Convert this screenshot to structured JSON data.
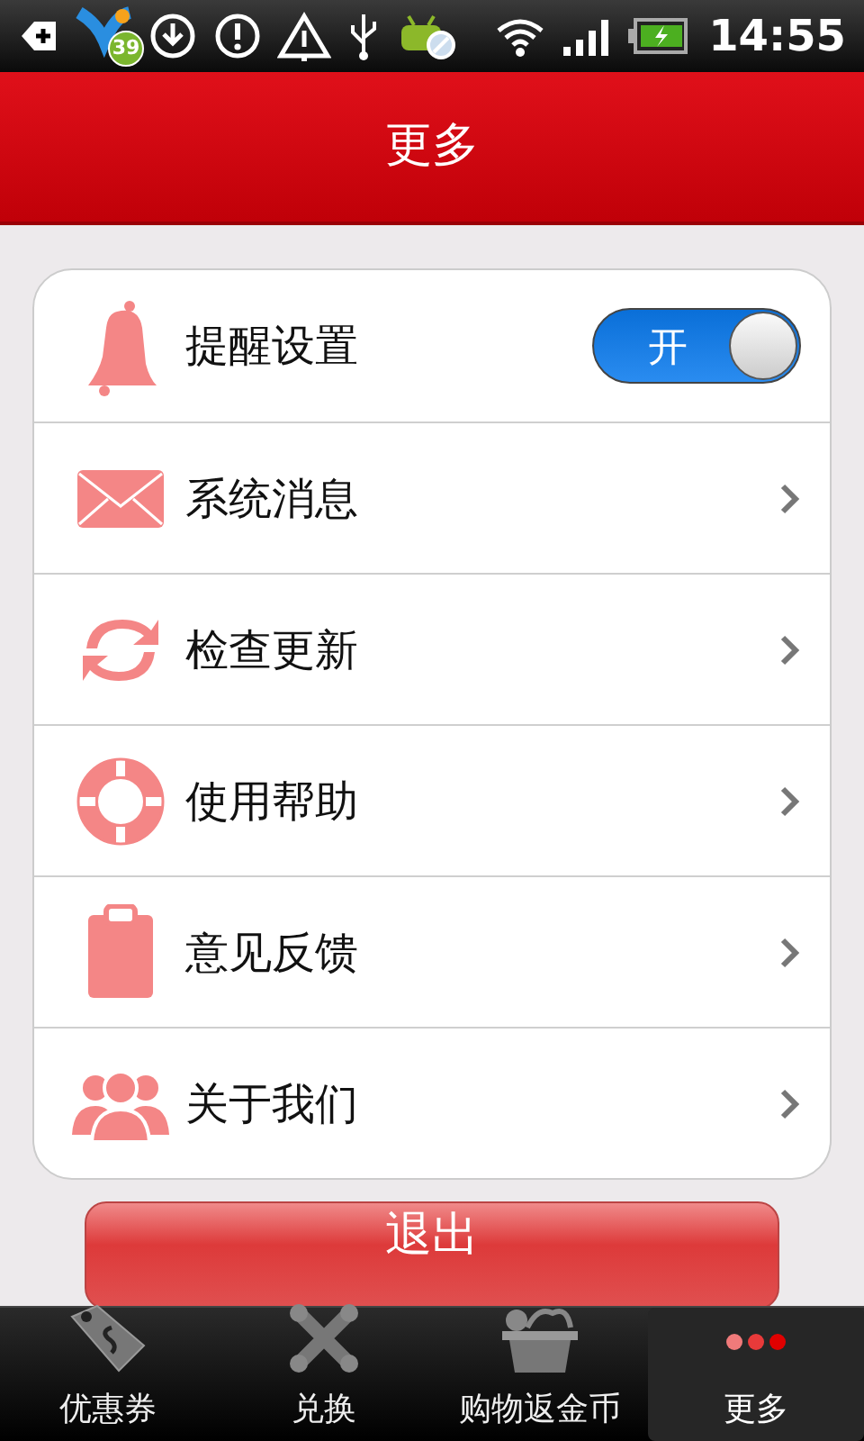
{
  "status_bar": {
    "badge": "39",
    "time": "14:55"
  },
  "header": {
    "title": "更多"
  },
  "settings": [
    {
      "kind": "toggle",
      "label": "提醒设置",
      "on": true,
      "toggle_label": "开"
    },
    {
      "kind": "link",
      "label": "系统消息"
    },
    {
      "kind": "link",
      "label": "检查更新"
    },
    {
      "kind": "link",
      "label": "使用帮助"
    },
    {
      "kind": "link",
      "label": "意见反馈"
    },
    {
      "kind": "link",
      "label": "关于我们"
    }
  ],
  "logout_button": "退出",
  "tabs": [
    {
      "label": "优惠券",
      "selected": false
    },
    {
      "label": "兑换",
      "selected": false
    },
    {
      "label": "购物返金币",
      "selected": false
    },
    {
      "label": "更多",
      "selected": true
    }
  ]
}
